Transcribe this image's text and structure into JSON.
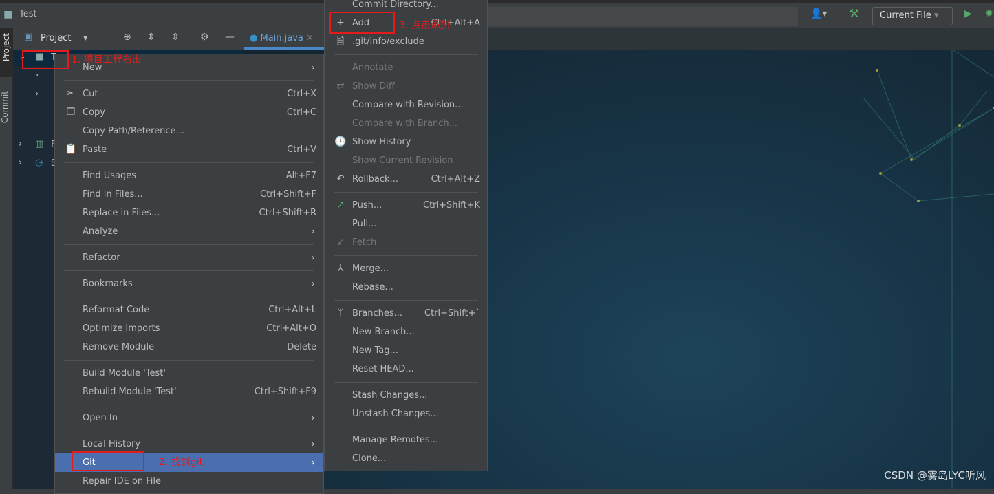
{
  "window": {
    "title": "Test"
  },
  "toolbar": {
    "run_config": "Current File"
  },
  "sidebar": {
    "project_tab": "Project",
    "commit_tab": "Commit"
  },
  "project_panel": {
    "title": "Project",
    "tree_root": "T",
    "tree_items": [
      "E",
      "S"
    ]
  },
  "editor": {
    "tab": "Main.java"
  },
  "context_menu": {
    "items": [
      {
        "label": "New",
        "arrow": true
      },
      {
        "sep": true
      },
      {
        "label": "Cut",
        "shortcut": "Ctrl+X",
        "icon": "scissors-icon",
        "glyph": "✂"
      },
      {
        "label": "Copy",
        "shortcut": "Ctrl+C",
        "icon": "copy-icon",
        "glyph": "❐"
      },
      {
        "label": "Copy Path/Reference..."
      },
      {
        "label": "Paste",
        "shortcut": "Ctrl+V",
        "icon": "clipboard-icon",
        "glyph": "📋"
      },
      {
        "sep": true
      },
      {
        "label": "Find Usages",
        "shortcut": "Alt+F7"
      },
      {
        "label": "Find in Files...",
        "shortcut": "Ctrl+Shift+F"
      },
      {
        "label": "Replace in Files...",
        "shortcut": "Ctrl+Shift+R"
      },
      {
        "label": "Analyze",
        "arrow": true
      },
      {
        "sep": true
      },
      {
        "label": "Refactor",
        "arrow": true
      },
      {
        "sep": true
      },
      {
        "label": "Bookmarks",
        "arrow": true
      },
      {
        "sep": true
      },
      {
        "label": "Reformat Code",
        "shortcut": "Ctrl+Alt+L"
      },
      {
        "label": "Optimize Imports",
        "shortcut": "Ctrl+Alt+O"
      },
      {
        "label": "Remove Module",
        "shortcut": "Delete"
      },
      {
        "sep": true
      },
      {
        "label": "Build Module 'Test'"
      },
      {
        "label": "Rebuild Module 'Test'",
        "shortcut": "Ctrl+Shift+F9"
      },
      {
        "sep": true
      },
      {
        "label": "Open In",
        "arrow": true
      },
      {
        "sep": true
      },
      {
        "label": "Local History",
        "arrow": true
      },
      {
        "label": "Git",
        "arrow": true,
        "selected": true
      },
      {
        "label": "Repair IDE on File"
      }
    ]
  },
  "git_menu": {
    "items": [
      {
        "label": "Commit Directory..."
      },
      {
        "label": "Add",
        "shortcut": "Ctrl+Alt+A",
        "icon": "plus-icon",
        "glyph": "+"
      },
      {
        "label": ".git/info/exclude",
        "icon": "ignore-file-icon",
        "glyph": "🗎"
      },
      {
        "sep": true
      },
      {
        "label": "Annotate",
        "disabled": true
      },
      {
        "label": "Show Diff",
        "disabled": true,
        "icon": "diff-icon",
        "glyph": "⇄"
      },
      {
        "label": "Compare with Revision..."
      },
      {
        "label": "Compare with Branch...",
        "disabled": true
      },
      {
        "label": "Show History",
        "icon": "clock-icon",
        "glyph": "🕓"
      },
      {
        "label": "Show Current Revision",
        "disabled": true
      },
      {
        "label": "Rollback...",
        "shortcut": "Ctrl+Alt+Z",
        "icon": "undo-icon",
        "glyph": "↶"
      },
      {
        "sep": true
      },
      {
        "label": "Push...",
        "shortcut": "Ctrl+Shift+K",
        "icon": "push-arrow-icon",
        "glyph": "↗"
      },
      {
        "label": "Pull..."
      },
      {
        "label": "Fetch",
        "disabled": true,
        "icon": "fetch-arrow-icon",
        "glyph": "↙"
      },
      {
        "sep": true
      },
      {
        "label": "Merge...",
        "icon": "merge-icon",
        "glyph": "⅄"
      },
      {
        "label": "Rebase..."
      },
      {
        "sep": true
      },
      {
        "label": "Branches...",
        "shortcut": "Ctrl+Shift+`",
        "icon": "branch-icon",
        "glyph": "ᛘ"
      },
      {
        "label": "New Branch..."
      },
      {
        "label": "New Tag..."
      },
      {
        "label": "Reset HEAD..."
      },
      {
        "sep": true
      },
      {
        "label": "Stash Changes..."
      },
      {
        "label": "Unstash Changes..."
      },
      {
        "sep": true
      },
      {
        "label": "Manage Remotes..."
      },
      {
        "label": "Clone..."
      }
    ]
  },
  "annotations": {
    "step1": "1. 项目工程右击",
    "step2": "2. 找到git",
    "step3": "3. 点击添加"
  },
  "watermark": "CSDN @雾岛LYC听风",
  "colors": {
    "selection": "#4b6eaf",
    "annotation": "#e31b1b",
    "menu_bg": "#3c3f41"
  }
}
